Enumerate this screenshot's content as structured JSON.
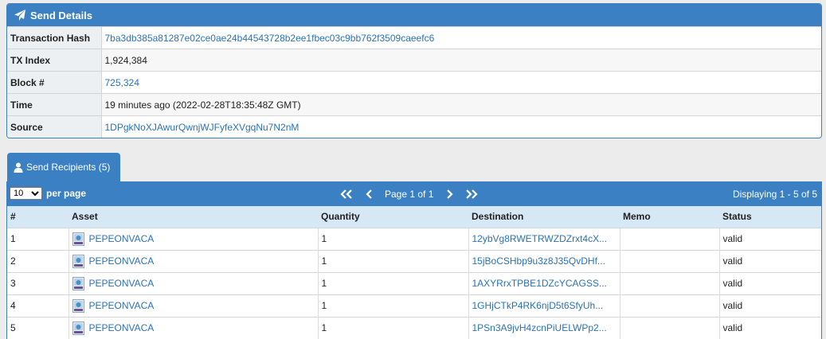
{
  "details": {
    "header": "Send Details",
    "rows": [
      {
        "label": "Transaction Hash",
        "value": "7ba3db385a81287e02ce0ae24b44543728b2ee1fbec03c9bb762f3509caeefc6"
      },
      {
        "label": "TX Index",
        "value": "1,924,384"
      },
      {
        "label": "Block #",
        "value": "725,324"
      },
      {
        "label": "Time",
        "value": "19 minutes ago (2022-02-28T18:35:48Z GMT)"
      },
      {
        "label": "Source",
        "value": "1DPgkNoXJAwurQwnjWJFyfeXVgqNu7N2nM"
      }
    ]
  },
  "recipients": {
    "tab_label": "Send Recipients (5)",
    "per_page_value": "10",
    "per_page_label": "per page",
    "page_text": "Page 1 of 1",
    "displaying": "Displaying 1 - 5 of 5",
    "columns": [
      "#",
      "Asset",
      "Quantity",
      "Destination",
      "Memo",
      "Status"
    ],
    "rows": [
      {
        "n": "1",
        "asset": "PEPEONVACA",
        "qty": "1",
        "dest": "12ybVg8RWETRWZDZrxt4cX...",
        "memo": "",
        "status": "valid"
      },
      {
        "n": "2",
        "asset": "PEPEONVACA",
        "qty": "1",
        "dest": "15jBoCSHbp9u3z8J35QvDHf...",
        "memo": "",
        "status": "valid"
      },
      {
        "n": "3",
        "asset": "PEPEONVACA",
        "qty": "1",
        "dest": "1AXYRrxTPBE1DZcYCAGSS...",
        "memo": "",
        "status": "valid"
      },
      {
        "n": "4",
        "asset": "PEPEONVACA",
        "qty": "1",
        "dest": "1GHjCTkP4RK6njD5t6SfyUh...",
        "memo": "",
        "status": "valid"
      },
      {
        "n": "5",
        "asset": "PEPEONVACA",
        "qty": "1",
        "dest": "1PSn3A9jvH4zcnPiUELWPp2...",
        "memo": "",
        "status": "valid"
      }
    ]
  },
  "icons": {
    "header_icon": "paper-plane-icon",
    "tab_icon": "user-icon",
    "asset_icon": "asset-thumbnail-icon"
  },
  "colors": {
    "accent": "#3a80c3",
    "link": "#2a72b8",
    "header_row": "#d6e8f5"
  }
}
